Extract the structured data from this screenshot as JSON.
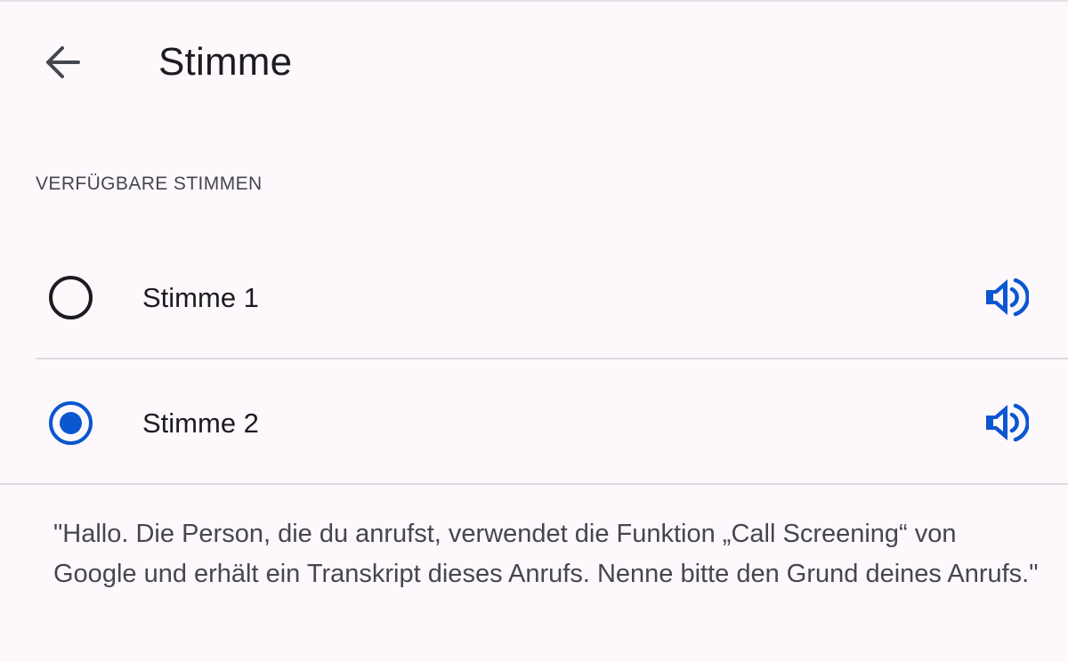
{
  "header": {
    "back_icon": "arrow-back-icon",
    "title": "Stimme"
  },
  "section": {
    "label": "VERFÜGBARE STIMMEN"
  },
  "voices": [
    {
      "label": "Stimme 1",
      "selected": false,
      "speaker_icon": "volume-up-icon"
    },
    {
      "label": "Stimme 2",
      "selected": true,
      "speaker_icon": "volume-up-icon"
    }
  ],
  "preview": {
    "text": "\"Hallo. Die Person, die du anrufst, verwendet die Funktion „Call Screening“ von Google und erhält ein Transkript dieses Anrufs. Nenne bitte den Grund deines Anrufs.\""
  },
  "colors": {
    "background": "#fdf8fc",
    "accent": "#0b57d0",
    "text_primary": "#1c1b1f",
    "text_secondary": "#46464f",
    "divider": "#dddadf"
  }
}
